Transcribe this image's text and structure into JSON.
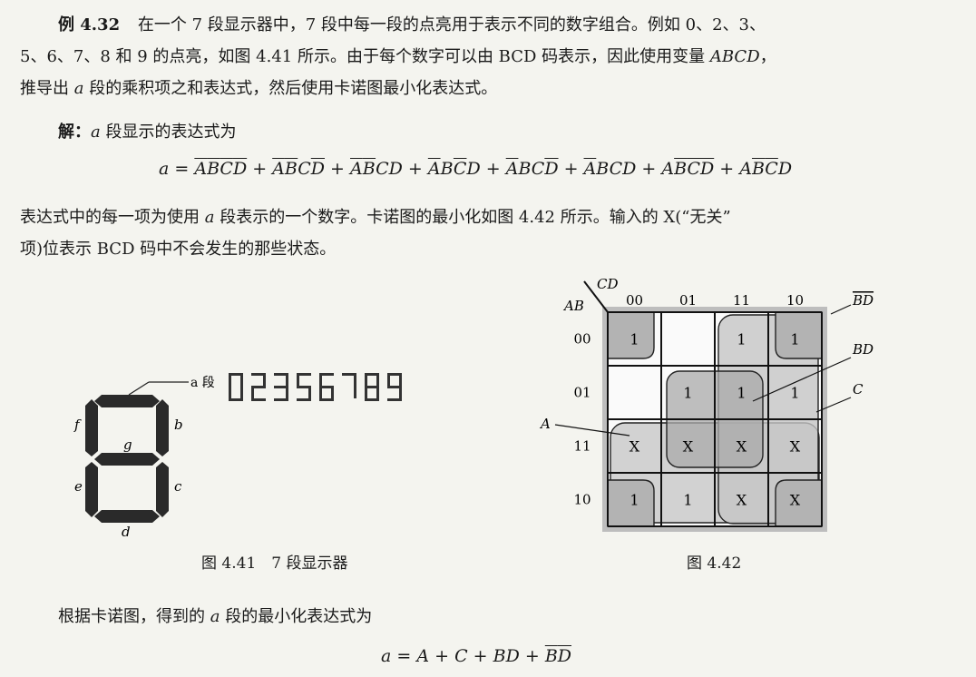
{
  "example": {
    "label": "例 4.32",
    "line1": "在一个 7 段显示器中，7 段中每一段的点亮用于表示不同的数字组合。例如 0、2、3、",
    "line2_pre": "5、6、7、8 和 9 的点亮，如图 4.41 所示。由于每个数字可以由 BCD 码表示，因此使用变量 ",
    "line2_var": "ABCD",
    "line2_post": "，",
    "line3_pre": "推导出 ",
    "line3_var": "a",
    "line3_post": " 段的乘积项之和表达式，然后使用卡诺图最小化表达式。"
  },
  "solution": {
    "label": "解：",
    "var": "a",
    "text": " 段显示的表达式为"
  },
  "equation1": {
    "lhs": "a",
    "eq": "=",
    "plus": "+",
    "terms": [
      [
        {
          "v": "A",
          "o": true
        },
        {
          "v": "B",
          "o": true
        },
        {
          "v": "C",
          "o": true
        },
        {
          "v": "D",
          "o": true
        }
      ],
      [
        {
          "v": "A",
          "o": true
        },
        {
          "v": "B",
          "o": true
        },
        {
          "v": "C",
          "o": false
        },
        {
          "v": "D",
          "o": true
        }
      ],
      [
        {
          "v": "A",
          "o": true
        },
        {
          "v": "B",
          "o": true
        },
        {
          "v": "C",
          "o": false
        },
        {
          "v": "D",
          "o": false
        }
      ],
      [
        {
          "v": "A",
          "o": true
        },
        {
          "v": "B",
          "o": false
        },
        {
          "v": "C",
          "o": true
        },
        {
          "v": "D",
          "o": false
        }
      ],
      [
        {
          "v": "A",
          "o": true
        },
        {
          "v": "B",
          "o": false
        },
        {
          "v": "C",
          "o": false
        },
        {
          "v": "D",
          "o": true
        }
      ],
      [
        {
          "v": "A",
          "o": true
        },
        {
          "v": "B",
          "o": false
        },
        {
          "v": "C",
          "o": false
        },
        {
          "v": "D",
          "o": false
        }
      ],
      [
        {
          "v": "A",
          "o": false
        },
        {
          "v": "B",
          "o": true
        },
        {
          "v": "C",
          "o": true
        },
        {
          "v": "D",
          "o": true
        }
      ],
      [
        {
          "v": "A",
          "o": false
        },
        {
          "v": "B",
          "o": true
        },
        {
          "v": "C",
          "o": true
        },
        {
          "v": "D",
          "o": false
        }
      ]
    ]
  },
  "explain": {
    "l1_pre": "表达式中的每一项为使用 ",
    "l1_var": "a",
    "l1_post": " 段表示的一个数字。卡诺图的最小化如图 4.42 所示。输入的 X(“无关”",
    "l2": "项)位表示 BCD 码中不会发生的那些状态。"
  },
  "fig441": {
    "seg_labels": {
      "a": "a",
      "b": "b",
      "c": "c",
      "d": "d",
      "e": "e",
      "f": "f",
      "g": "g"
    },
    "a_label": "a 段",
    "digits": "02356789",
    "caption": "图 4.41　7 段显示器"
  },
  "fig442": {
    "row_var": "AB",
    "col_var": "CD",
    "col_headers": [
      "00",
      "01",
      "11",
      "10"
    ],
    "row_headers": [
      "00",
      "01",
      "11",
      "10"
    ],
    "cells": [
      [
        "1",
        "",
        "1",
        "1"
      ],
      [
        "",
        "1",
        "1",
        "1"
      ],
      [
        "X",
        "X",
        "X",
        "X"
      ],
      [
        "1",
        "1",
        "X",
        "X"
      ]
    ],
    "group_labels": {
      "bd_bar": "BD",
      "bd": "BD",
      "c": "C",
      "a": "A"
    },
    "caption": "图 4.42"
  },
  "result": {
    "text": "根据卡诺图，得到的 ",
    "var": "a",
    "post": " 段的最小化表达式为"
  },
  "equation2": {
    "lhs": "a",
    "rhs": [
      {
        "t": "A",
        "o": false
      },
      {
        "t": " + ",
        "op": true
      },
      {
        "t": "C",
        "o": false
      },
      {
        "t": " + ",
        "op": true
      },
      {
        "t": "BD",
        "o": false
      },
      {
        "t": " + ",
        "op": true
      },
      {
        "t": "B",
        "o": true
      },
      {
        "t": "D",
        "o": true
      }
    ]
  }
}
